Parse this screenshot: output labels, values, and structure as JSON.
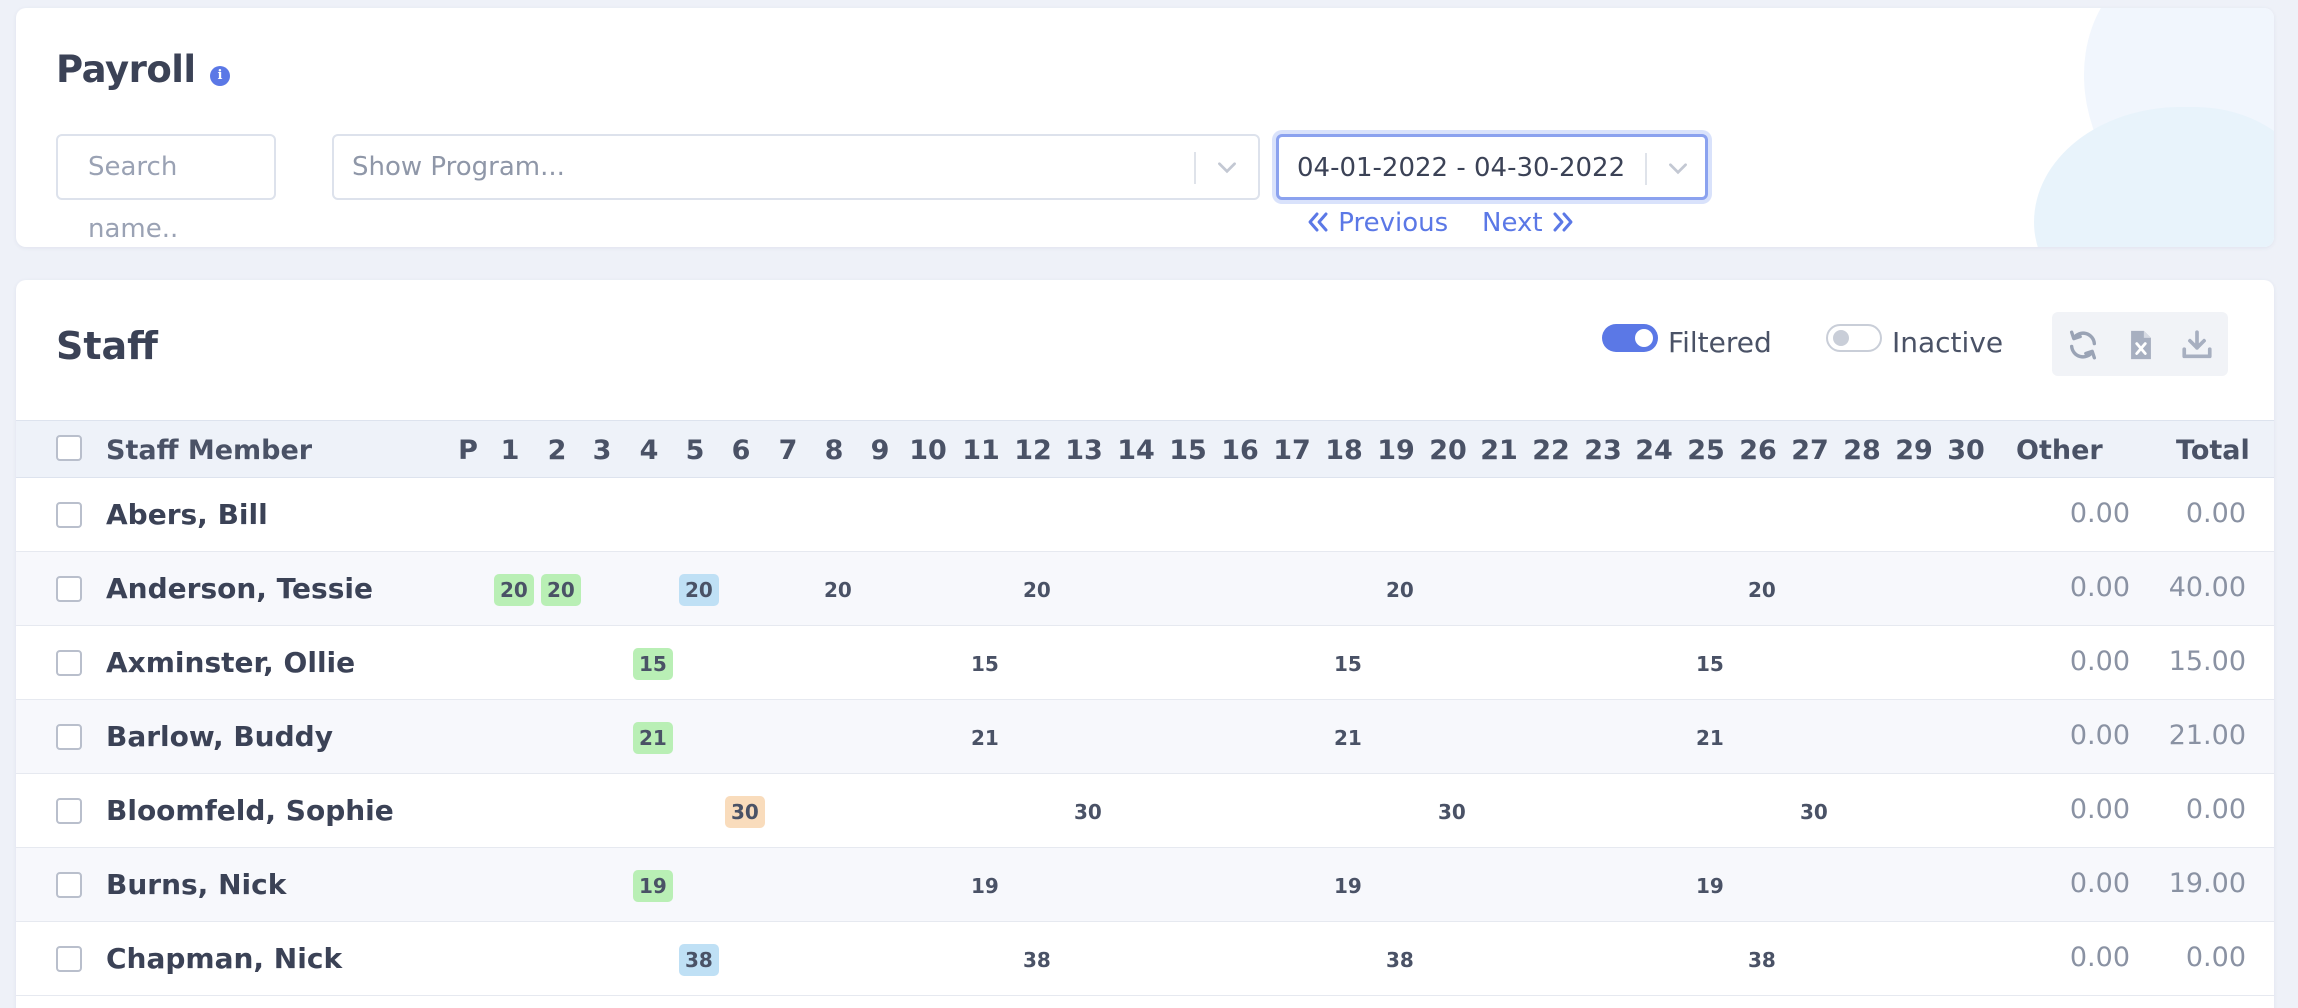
{
  "header": {
    "title": "Payroll",
    "info_icon": "info-icon",
    "search_placeholder": "Search name..",
    "program_placeholder": "Show Program...",
    "date_range": "04-01-2022 - 04-30-2022",
    "previous_label": "Previous",
    "next_label": "Next"
  },
  "staff": {
    "title": "Staff",
    "filtered_label": "Filtered",
    "filtered_on": true,
    "inactive_label": "Inactive",
    "inactive_on": false,
    "tools": [
      "refresh-icon",
      "excel-icon",
      "download-icon"
    ]
  },
  "table": {
    "columns": {
      "staff_member": "Staff Member",
      "p": "P",
      "days": [
        "1",
        "2",
        "3",
        "4",
        "5",
        "6",
        "7",
        "8",
        "9",
        "10",
        "11",
        "12",
        "13",
        "14",
        "15",
        "16",
        "17",
        "18",
        "19",
        "20",
        "21",
        "22",
        "23",
        "24",
        "25",
        "26",
        "27",
        "28",
        "29",
        "30"
      ],
      "other": "Other",
      "total": "Total"
    },
    "rows": [
      {
        "name": "Abers, Bill",
        "other": "0.00",
        "total": "0.00",
        "cells": []
      },
      {
        "name": "Anderson, Tessie",
        "other": "0.00",
        "total": "40.00",
        "cells": [
          {
            "day": 1,
            "value": "20",
            "color": "green"
          },
          {
            "day": 2,
            "value": "20",
            "color": "green"
          },
          {
            "day": 5,
            "value": "20",
            "color": "blue"
          },
          {
            "day": 8,
            "value": "20",
            "color": "none"
          },
          {
            "day": 12,
            "value": "20",
            "color": "none"
          },
          {
            "day": 19,
            "value": "20",
            "color": "none"
          },
          {
            "day": 26,
            "value": "20",
            "color": "none"
          }
        ]
      },
      {
        "name": "Axminster, Ollie",
        "other": "0.00",
        "total": "15.00",
        "cells": [
          {
            "day": 4,
            "value": "15",
            "color": "green"
          },
          {
            "day": 11,
            "value": "15",
            "color": "none"
          },
          {
            "day": 18,
            "value": "15",
            "color": "none"
          },
          {
            "day": 25,
            "value": "15",
            "color": "none"
          }
        ]
      },
      {
        "name": "Barlow, Buddy",
        "other": "0.00",
        "total": "21.00",
        "cells": [
          {
            "day": 4,
            "value": "21",
            "color": "green"
          },
          {
            "day": 11,
            "value": "21",
            "color": "none"
          },
          {
            "day": 18,
            "value": "21",
            "color": "none"
          },
          {
            "day": 25,
            "value": "21",
            "color": "none"
          }
        ]
      },
      {
        "name": "Bloomfeld, Sophie",
        "other": "0.00",
        "total": "0.00",
        "cells": [
          {
            "day": 6,
            "value": "30",
            "color": "orange"
          },
          {
            "day": 13,
            "value": "30",
            "color": "none"
          },
          {
            "day": 20,
            "value": "30",
            "color": "none"
          },
          {
            "day": 27,
            "value": "30",
            "color": "none"
          }
        ]
      },
      {
        "name": "Burns, Nick",
        "other": "0.00",
        "total": "19.00",
        "cells": [
          {
            "day": 4,
            "value": "19",
            "color": "green"
          },
          {
            "day": 11,
            "value": "19",
            "color": "none"
          },
          {
            "day": 18,
            "value": "19",
            "color": "none"
          },
          {
            "day": 25,
            "value": "19",
            "color": "none"
          }
        ]
      },
      {
        "name": "Chapman, Nick",
        "other": "0.00",
        "total": "0.00",
        "cells": [
          {
            "day": 5,
            "value": "38",
            "color": "blue"
          },
          {
            "day": 12,
            "value": "38",
            "color": "none"
          },
          {
            "day": 19,
            "value": "38",
            "color": "none"
          },
          {
            "day": 26,
            "value": "38",
            "color": "none"
          }
        ]
      }
    ]
  },
  "colors": {
    "accent": "#5b78e6",
    "badge_green": "#b9efb5",
    "badge_blue": "#bfe0f5",
    "badge_orange": "#f9dcbc"
  }
}
